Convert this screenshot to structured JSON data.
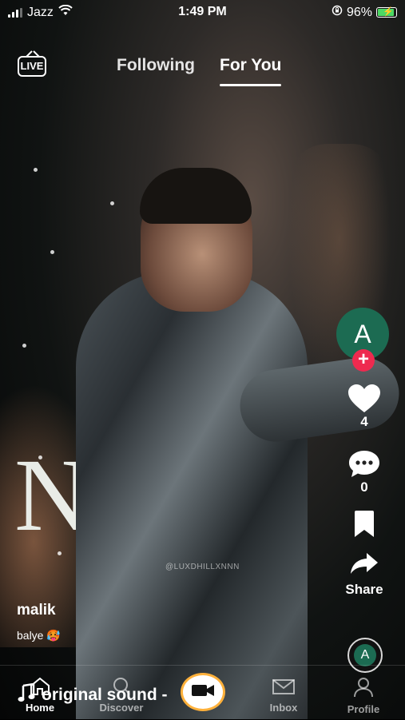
{
  "status_bar": {
    "carrier": "Jazz",
    "time": "1:49 PM",
    "battery_percent": "96%",
    "icons": [
      "signal-icon",
      "wifi-icon",
      "orientation-lock-icon",
      "battery-charging-icon"
    ]
  },
  "header": {
    "live_label": "LIVE",
    "tabs": [
      {
        "label": "Following",
        "active": false
      },
      {
        "label": "For You",
        "active": true
      }
    ]
  },
  "video": {
    "overlay_text": "N",
    "watermark": "@LUXDHILLXNNN"
  },
  "creator": {
    "avatar_letter": "A",
    "avatar_color": "#1c6b52",
    "follow_label": "+"
  },
  "actions": {
    "likes": "4",
    "comments": "0",
    "share_label": "Share",
    "icons": [
      "heart-icon",
      "comment-icon",
      "bookmark-icon",
      "share-icon"
    ]
  },
  "caption": {
    "username": "malik",
    "description": "balye 🥵"
  },
  "sound": {
    "title": "original sound -",
    "disc_letter": "A"
  },
  "bottom_nav": {
    "items": [
      {
        "label": "Home",
        "icon": "home-icon",
        "active": true
      },
      {
        "label": "Discover",
        "icon": "search-icon",
        "active": false
      },
      {
        "label": "Inbox",
        "icon": "inbox-icon",
        "active": false
      },
      {
        "label": "Profile",
        "icon": "profile-icon",
        "active": false
      }
    ],
    "create_icon": "video-camera-icon"
  },
  "colors": {
    "accent_follow": "#ee2a4f",
    "create_ring": "#ffb13b",
    "battery_green": "#4cd964"
  }
}
